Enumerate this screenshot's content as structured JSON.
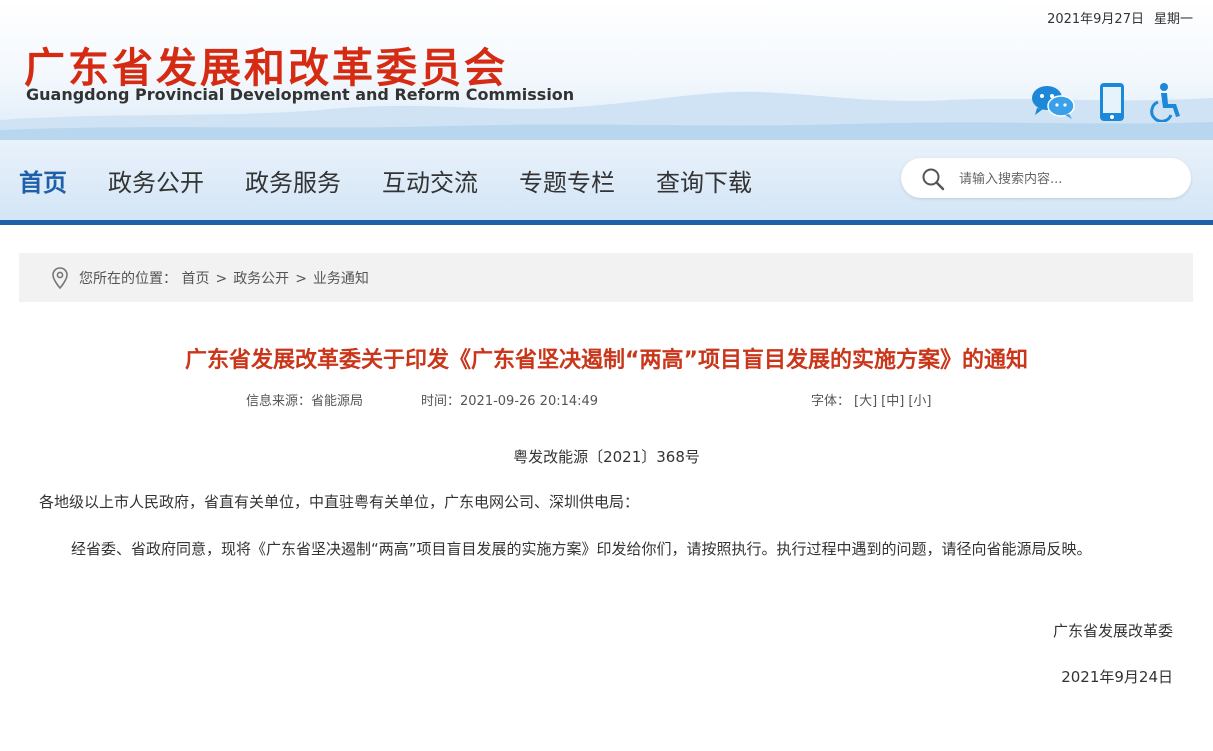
{
  "header": {
    "date": "2021年9月27日",
    "weekday": "星期一",
    "site_name_cn": "广东省发展和改革委员会",
    "site_name_en": "Guangdong Provincial Development and Reform Commission",
    "icons": [
      "wechat-icon",
      "mobile-icon",
      "accessibility-icon"
    ]
  },
  "nav": {
    "items": [
      "首页",
      "政务公开",
      "政务服务",
      "互动交流",
      "专题专栏",
      "查询下载"
    ],
    "active_index": 0,
    "search_placeholder": "请输入搜索内容..."
  },
  "breadcrumb": {
    "label": "您所在的位置：",
    "items": [
      "首页",
      "政务公开",
      "业务通知"
    ],
    "separator": ">"
  },
  "article": {
    "title": "广东省发展改革委关于印发《广东省坚决遏制“两高”项目盲目发展的实施方案》的通知",
    "source": "信息来源：省能源局",
    "time": "时间：2021-09-26 20:14:49",
    "font_label": "字体：",
    "font_sizes": [
      "[大]",
      "[中]",
      "[小]"
    ],
    "doc_no": "粤发改能源〔2021〕368号",
    "addressee": "各地级以上市人民政府，省直有关单位，中直驻粤有关单位，广东电网公司、深圳供电局：",
    "body": "经省委、省政府同意，现将《广东省坚决遏制“两高”项目盲目发展的实施方案》印发给你们，请按照执行。执行过程中遇到的问题，请径向省能源局反映。",
    "signer": "广东省发展改革委",
    "sign_date": "2021年9月24日"
  },
  "colors": {
    "brand_red": "#d52b12",
    "title_red": "#c9361a",
    "nav_blue": "#1f5ea8",
    "icon_blue": "#1e88d8"
  }
}
